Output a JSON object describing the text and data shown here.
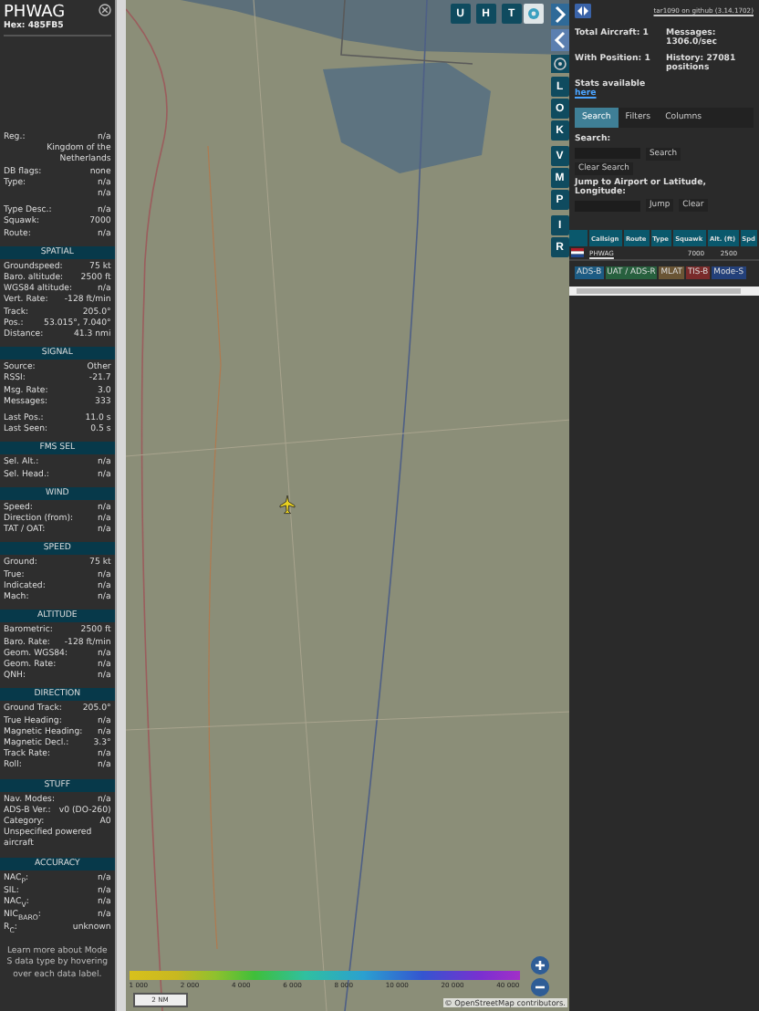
{
  "details": {
    "title": "PHWAG",
    "hex": "Hex: 485FB5",
    "sections": [
      {
        "groups": [
          [
            {
              "kind": "pair",
              "label": "Reg.:",
              "value": "n/a"
            },
            {
              "kind": "value",
              "value": "Kingdom of the Netherlands"
            },
            {
              "kind": "pair",
              "label": "DB flags:",
              "value": "none"
            },
            {
              "kind": "pair",
              "label": "Type:",
              "value": "n/a"
            },
            {
              "kind": "value",
              "value": "n/a"
            }
          ],
          [
            {
              "kind": "pair",
              "label": "Type Desc.:",
              "value": "n/a"
            },
            {
              "kind": "pair",
              "label": "Squawk:",
              "value": "7000"
            },
            {
              "kind": "pair",
              "label": "Route:",
              "value": "n/a"
            }
          ]
        ]
      },
      {
        "title": "SPATIAL",
        "groups": [
          [
            {
              "kind": "pair",
              "label": "Groundspeed:",
              "value": "75 kt"
            },
            {
              "kind": "pair",
              "label": "Baro. altitude:",
              "value": "2500 ft"
            },
            {
              "kind": "pair",
              "label": "WGS84 altitude:",
              "value": "n/a"
            },
            {
              "kind": "pair",
              "label": "Vert. Rate:",
              "value": "-128 ft/min"
            },
            {
              "kind": "pair",
              "label": "Track:",
              "value": "205.0°"
            },
            {
              "kind": "pair",
              "label": "Pos.:",
              "value": "53.015°, 7.040°"
            },
            {
              "kind": "pair",
              "label": "Distance:",
              "value": "41.3 nmi"
            }
          ]
        ]
      },
      {
        "title": "SIGNAL",
        "groups": [
          [
            {
              "kind": "pair",
              "label": "Source:",
              "value": "Other"
            },
            {
              "kind": "pair",
              "label": "RSSI:",
              "value": "-21.7"
            },
            {
              "kind": "pair",
              "label": "Msg. Rate:",
              "value": "3.0"
            },
            {
              "kind": "pair",
              "label": "Messages:",
              "value": "333"
            }
          ],
          [
            {
              "kind": "pair",
              "label": "Last Pos.:",
              "value": "11.0 s"
            },
            {
              "kind": "pair",
              "label": "Last Seen:",
              "value": "0.5 s"
            }
          ]
        ]
      },
      {
        "title": "FMS SEL",
        "groups": [
          [
            {
              "kind": "pair",
              "label": "Sel. Alt.:",
              "value": "n/a"
            },
            {
              "kind": "pair",
              "label": "Sel. Head.:",
              "value": "n/a"
            }
          ]
        ]
      },
      {
        "title": "WIND",
        "groups": [
          [
            {
              "kind": "pair",
              "label": "Speed:",
              "value": "n/a"
            },
            {
              "kind": "pair",
              "label": "Direction (from):",
              "value": "n/a"
            },
            {
              "kind": "pair",
              "label": "TAT / OAT:",
              "value": "n/a"
            }
          ]
        ]
      },
      {
        "title": "SPEED",
        "groups": [
          [
            {
              "kind": "pair",
              "label": "Ground:",
              "value": "75 kt"
            },
            {
              "kind": "pair",
              "label": "True:",
              "value": "n/a"
            },
            {
              "kind": "pair",
              "label": "Indicated:",
              "value": "n/a"
            },
            {
              "kind": "pair",
              "label": "Mach:",
              "value": "n/a"
            }
          ]
        ]
      },
      {
        "title": "ALTITUDE",
        "groups": [
          [
            {
              "kind": "pair",
              "label": "Barometric:",
              "value": "2500 ft"
            },
            {
              "kind": "pair",
              "label": "Baro. Rate:",
              "value": "-128 ft/min"
            },
            {
              "kind": "pair",
              "label": "Geom. WGS84:",
              "value": "n/a"
            },
            {
              "kind": "pair",
              "label": "Geom. Rate:",
              "value": "n/a"
            },
            {
              "kind": "pair",
              "label": "QNH:",
              "value": "n/a"
            }
          ]
        ]
      },
      {
        "title": "DIRECTION",
        "groups": [
          [
            {
              "kind": "pair",
              "label": "Ground Track:",
              "value": "205.0°"
            },
            {
              "kind": "pair",
              "label": "True Heading:",
              "value": "n/a"
            },
            {
              "kind": "pair",
              "label": "Magnetic Heading:",
              "value": "n/a"
            },
            {
              "kind": "pair",
              "label": "Magnetic Decl.:",
              "value": "3.3°"
            },
            {
              "kind": "pair",
              "label": "Track Rate:",
              "value": "n/a"
            },
            {
              "kind": "pair",
              "label": "Roll:",
              "value": "n/a"
            }
          ]
        ]
      },
      {
        "title": "STUFF",
        "groups": [
          [
            {
              "kind": "pair",
              "label": "Nav. Modes:",
              "value": "n/a"
            },
            {
              "kind": "pair",
              "label": "ADS-B Ver.:",
              "value": "v0 (DO-260)"
            },
            {
              "kind": "pair",
              "label": "Category:",
              "value": "A0"
            },
            {
              "kind": "text",
              "value": "Unspecified powered aircraft"
            }
          ]
        ]
      },
      {
        "title": "ACCURACY",
        "groups": [
          [
            {
              "kind": "pair",
              "label": "NAC$_{P}$:",
              "value": "n/a"
            },
            {
              "kind": "pair",
              "label": "SIL:",
              "value": "n/a"
            },
            {
              "kind": "pair",
              "label": "NAC$_{V}$:",
              "value": "n/a"
            },
            {
              "kind": "pair",
              "label": "NIC$_{BARO}$:",
              "value": "n/a"
            },
            {
              "kind": "pair",
              "label": "R$_{C}$:",
              "value": "unknown"
            }
          ]
        ]
      }
    ],
    "note": "Learn more about Mode S data type by hovering over each data label."
  },
  "map": {
    "top_buttons": [
      "U",
      "H",
      "T"
    ],
    "side_buttons": [
      "L",
      "O",
      "K",
      "V",
      "M",
      "P",
      "I",
      "R"
    ],
    "legend": [
      "1 000",
      "2 000",
      "4 000",
      "6 000",
      "8 000",
      "10 000",
      "20 000",
      "40 000"
    ],
    "scale": "2 NM",
    "attribution": "© OpenStreetMap contributors."
  },
  "sidebar": {
    "version_link": "tar1090 on github (3.14.1702)",
    "stats": [
      {
        "label": "Total Aircraft:",
        "value": "1"
      },
      {
        "label": "Messages:",
        "value": "1306.0/sec"
      },
      {
        "label": "With Position:",
        "value": "1"
      },
      {
        "label": "History:",
        "value": "27081 positions"
      }
    ],
    "stats_text": "Stats available",
    "stats_link": "here",
    "tabs": [
      {
        "label": "Search",
        "selected": true
      },
      {
        "label": "Filters",
        "selected": false
      },
      {
        "label": "Columns",
        "selected": false
      }
    ],
    "search_label": "Search:",
    "search_button": "Search",
    "clear_search_button": "Clear Search",
    "jump_label": "Jump to Airport or Latitude, Longitude:",
    "jump_button": "Jump",
    "clear_button": "Clear",
    "table": {
      "columns": [
        "Callsign",
        "Route",
        "Type",
        "Squawk",
        "Alt. (ft)",
        "Spd"
      ],
      "rows": [
        {
          "cells": [
            "PHWAG",
            "",
            "",
            "7000",
            "2500",
            ""
          ],
          "selected": false
        }
      ]
    },
    "legend": [
      {
        "label": "ADS-B",
        "color": "#1c5b83"
      },
      {
        "label": "UAT / ADS-R",
        "color": "#27603e"
      },
      {
        "label": "MLAT",
        "color": "#6a5535"
      },
      {
        "label": "TIS-B",
        "color": "#7a2b2b"
      },
      {
        "label": "Mode-S",
        "color": "#23407a"
      }
    ]
  }
}
